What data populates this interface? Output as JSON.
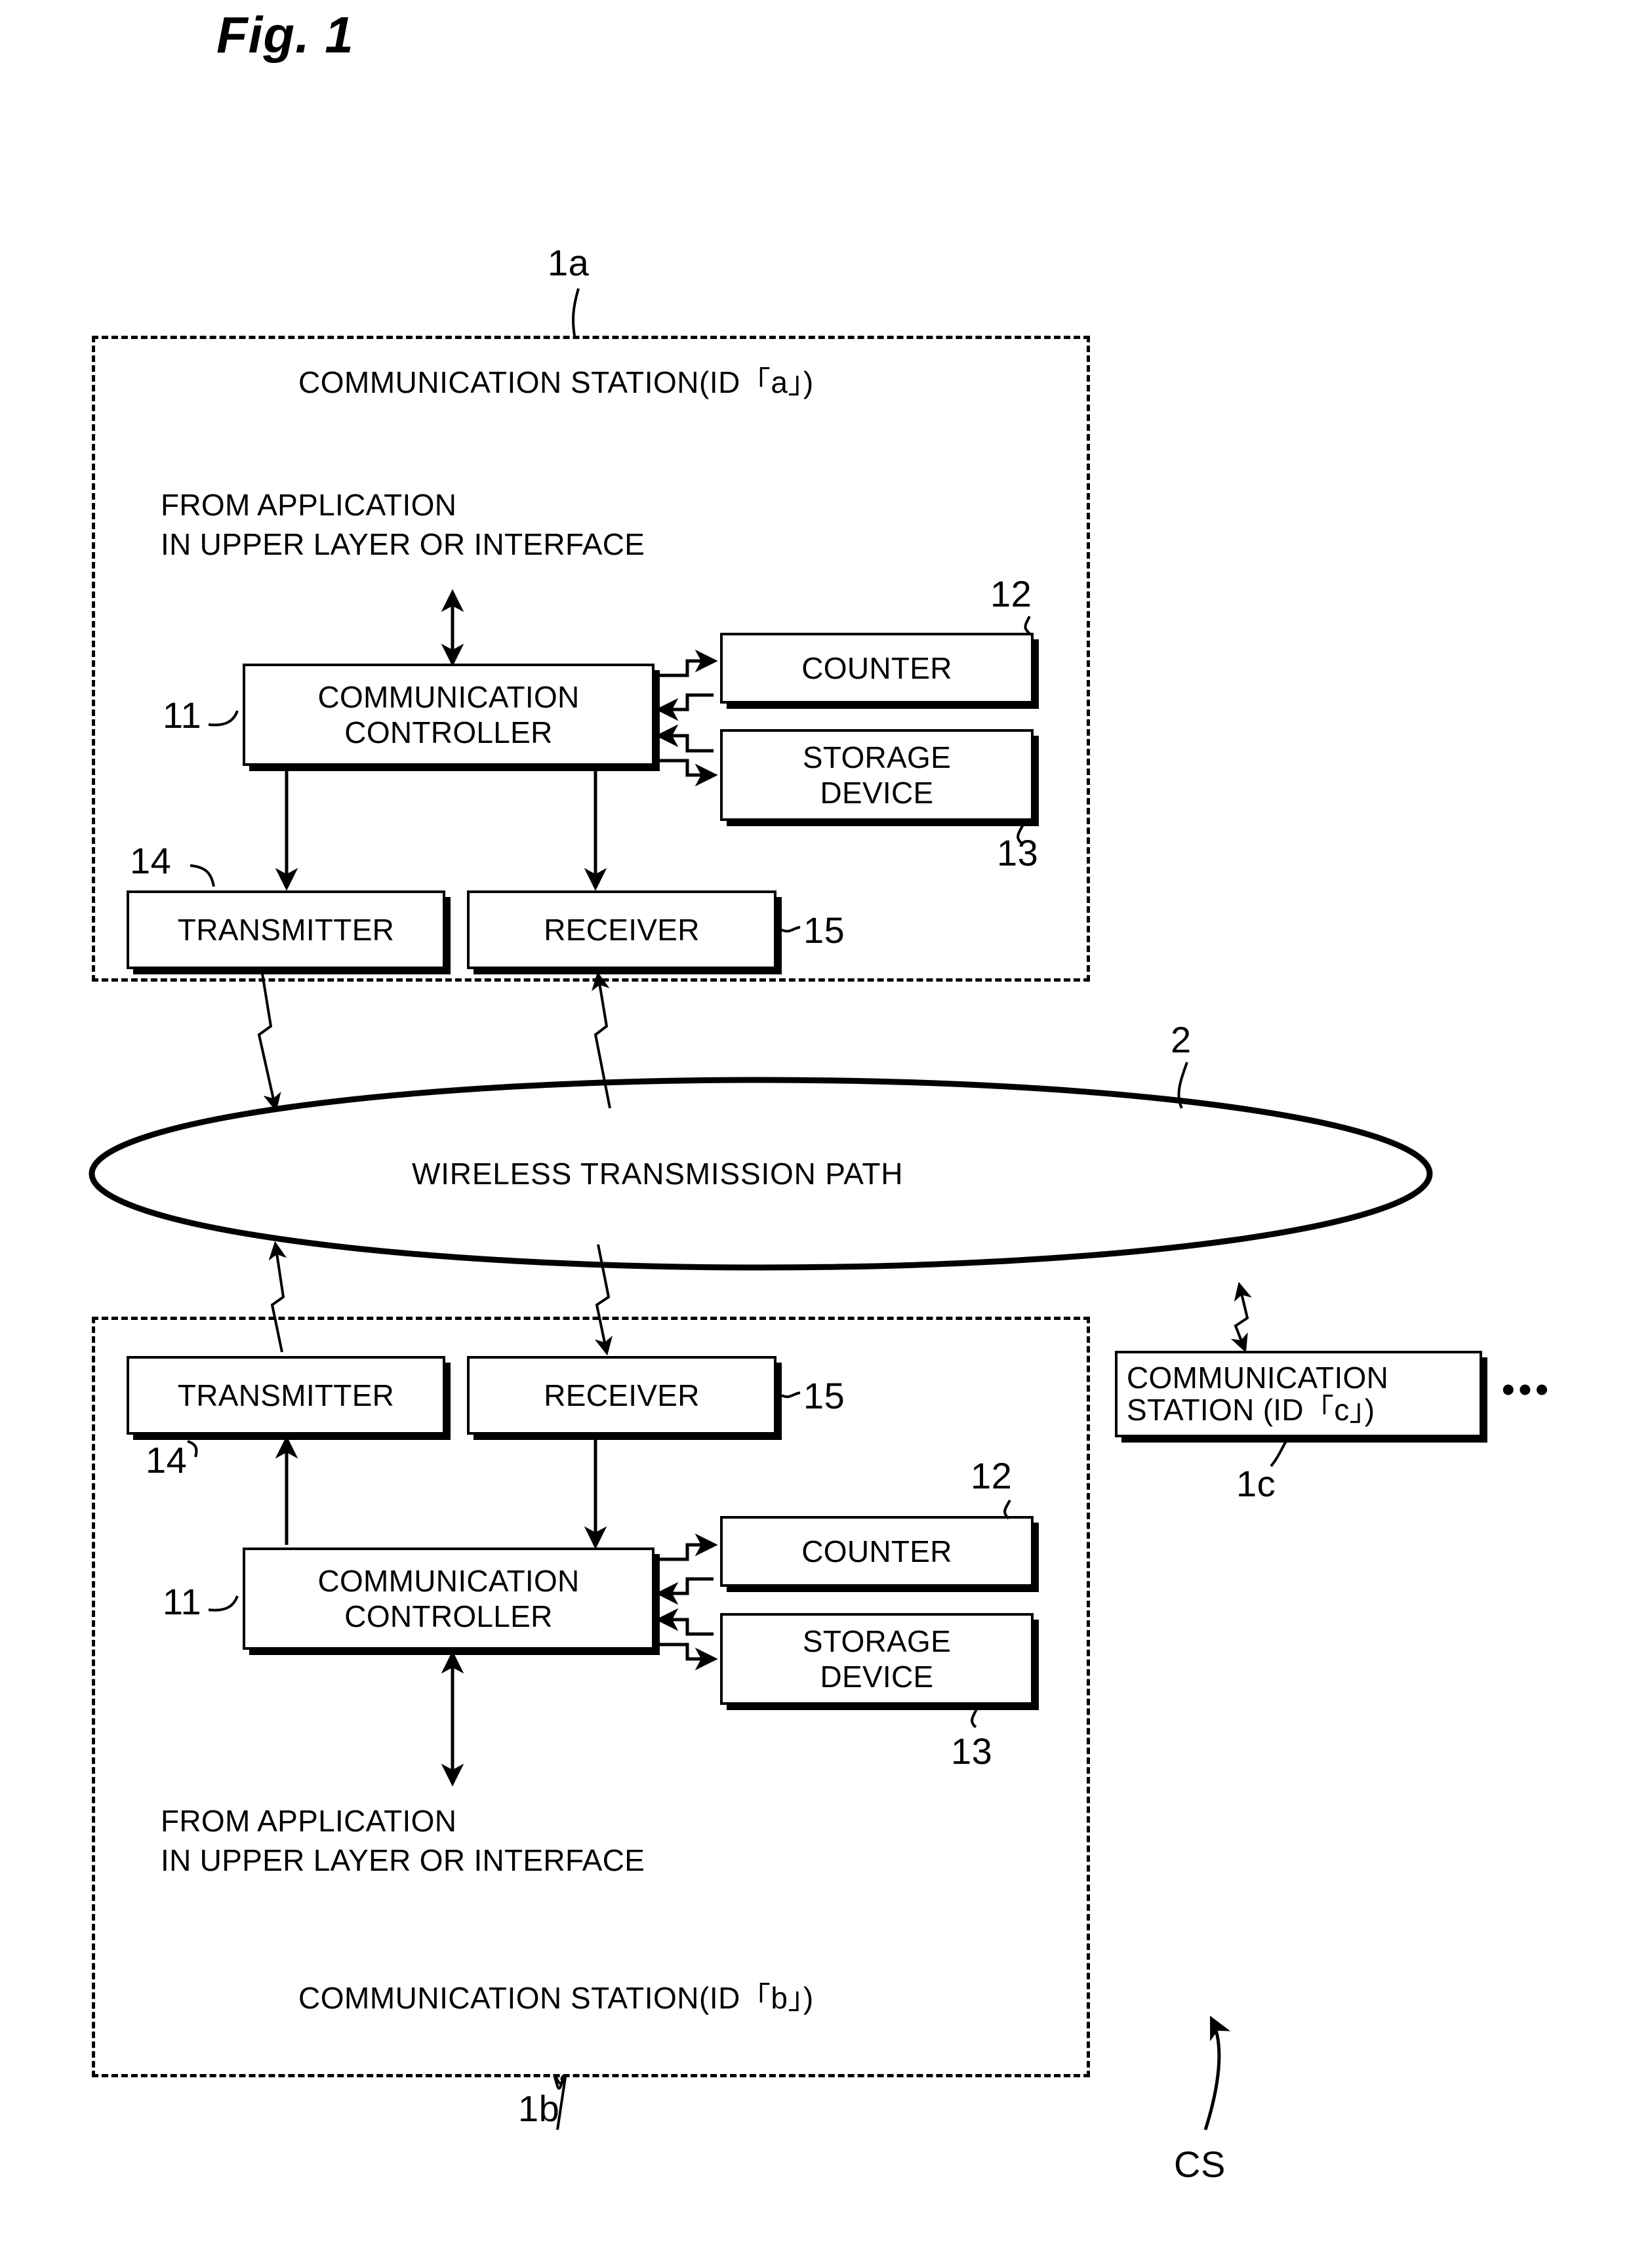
{
  "figure": {
    "title": "Fig. 1",
    "system_label": "CS"
  },
  "station_a": {
    "ref": "1a",
    "title": "COMMUNICATION STATION(ID「a」)",
    "app_note_line1": "FROM APPLICATION",
    "app_note_line2": "IN UPPER LAYER OR INTERFACE",
    "blocks": {
      "controller": {
        "ref": "11",
        "line1": "COMMUNICATION",
        "line2": "CONTROLLER"
      },
      "counter": {
        "ref": "12",
        "label": "COUNTER"
      },
      "storage": {
        "ref": "13",
        "line1": "STORAGE",
        "line2": "DEVICE"
      },
      "transmitter": {
        "ref": "14",
        "label": "TRANSMITTER"
      },
      "receiver": {
        "ref": "15",
        "label": "RECEIVER"
      }
    }
  },
  "station_b": {
    "ref": "1b",
    "title": "COMMUNICATION STATION(ID「b」)",
    "app_note_line1": "FROM APPLICATION",
    "app_note_line2": "IN UPPER LAYER OR INTERFACE",
    "blocks": {
      "controller": {
        "ref": "11",
        "line1": "COMMUNICATION",
        "line2": "CONTROLLER"
      },
      "counter": {
        "ref": "12",
        "label": "COUNTER"
      },
      "storage": {
        "ref": "13",
        "line1": "STORAGE",
        "line2": "DEVICE"
      },
      "transmitter": {
        "ref": "14",
        "label": "TRANSMITTER"
      },
      "receiver": {
        "ref": "15",
        "label": "RECEIVER"
      }
    }
  },
  "station_c": {
    "ref": "1c",
    "line1": "COMMUNICATION",
    "line2": "STATION (ID「c」)",
    "more_indicator": "•••"
  },
  "medium": {
    "ref": "2",
    "label": "WIRELESS TRANSMISSION PATH"
  },
  "colors": {
    "ink": "#000000",
    "paper": "#ffffff"
  }
}
